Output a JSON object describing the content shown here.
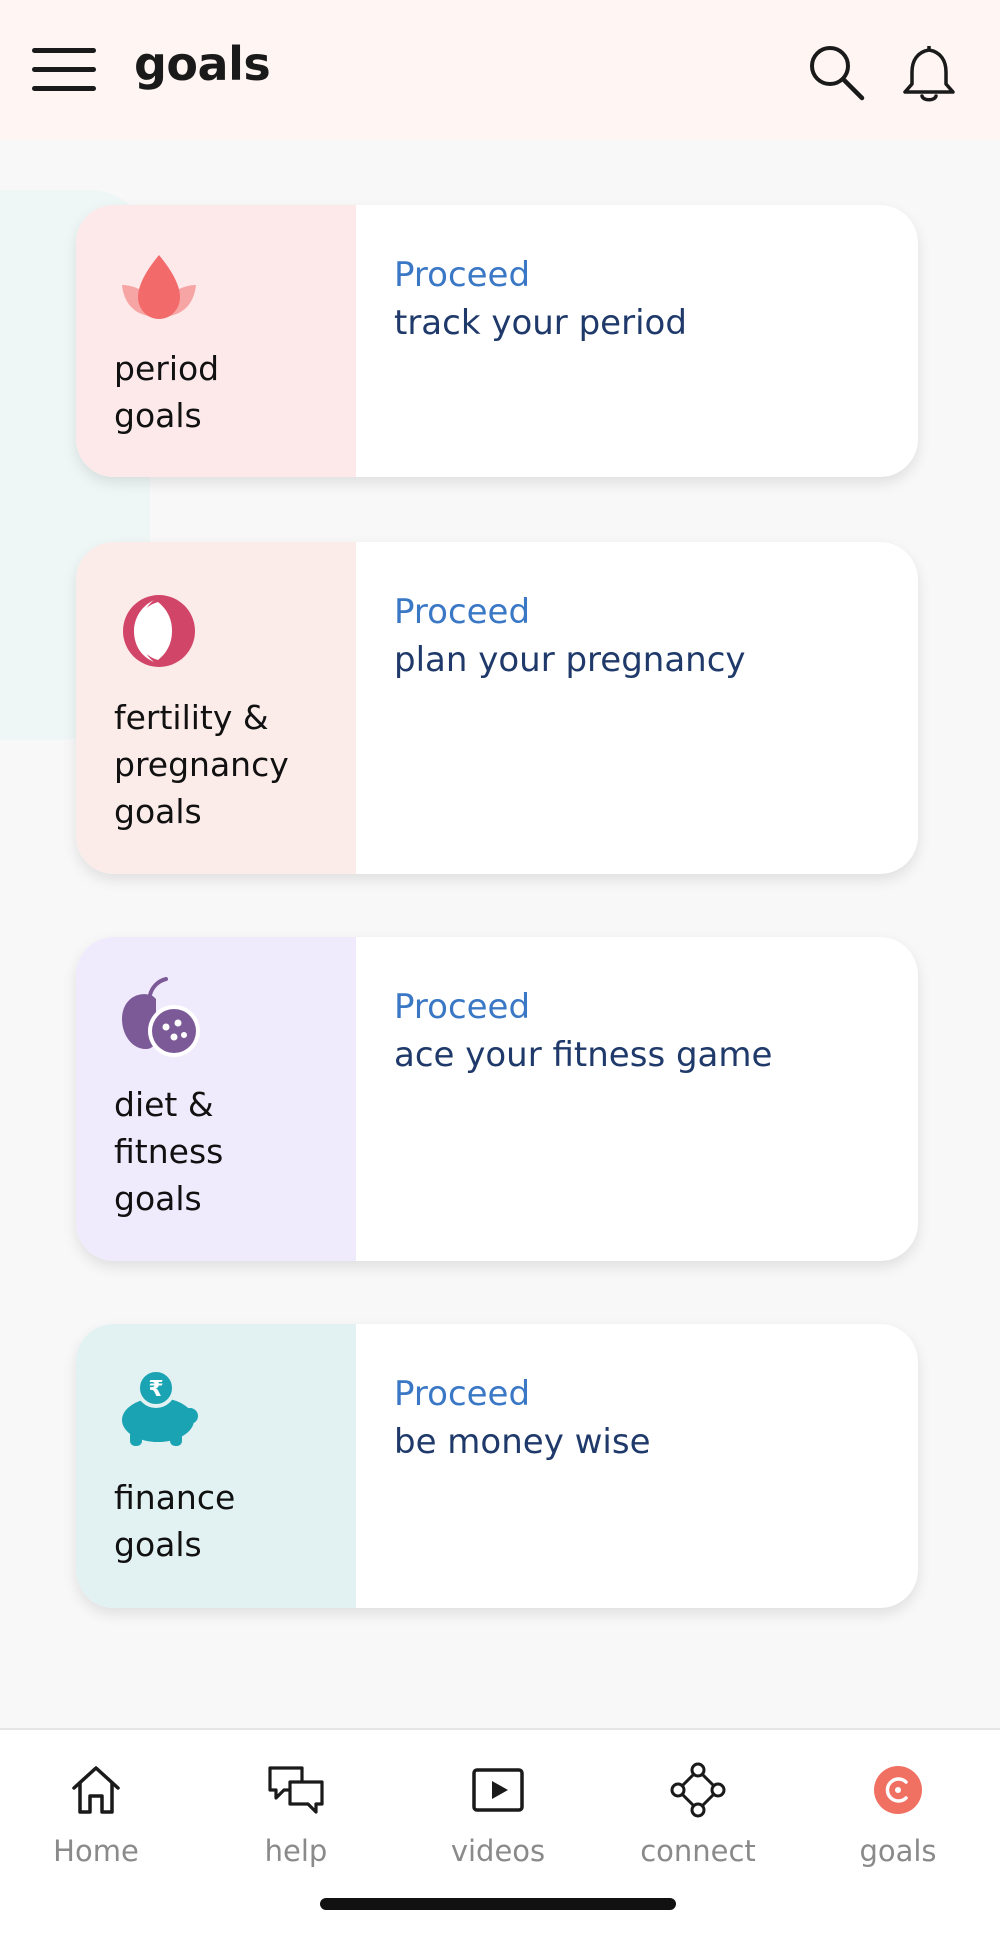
{
  "header": {
    "title": "goals",
    "menu_icon": "hamburger-menu-icon",
    "search_icon": "search-icon",
    "bell_icon": "bell-icon"
  },
  "cards": [
    {
      "name": "period\ngoals",
      "proceed": "Proceed",
      "description": "track your period",
      "icon": "lotus-icon",
      "bg_color": "#fde9ea",
      "icon_color": "#f26a6a"
    },
    {
      "name": "fertility &\npregnancy\ngoals",
      "proceed": "Proceed",
      "description": "plan your pregnancy",
      "icon": "moon-icon",
      "bg_color": "#fbecea",
      "icon_color": "#d14568"
    },
    {
      "name": "diet &\nfitness\ngoals",
      "proceed": "Proceed",
      "description": "ace your fitness game",
      "icon": "fruit-icon",
      "bg_color": "#f0ebfc",
      "icon_color": "#7c5a98"
    },
    {
      "name": "finance\ngoals",
      "proceed": "Proceed",
      "description": "be money wise",
      "icon": "piggy-bank-icon",
      "bg_color": "#e2f2f2",
      "icon_color": "#1aa3b2"
    }
  ],
  "nav": [
    {
      "label": "Home",
      "icon": "home-icon"
    },
    {
      "label": "help",
      "icon": "chat-icon"
    },
    {
      "label": "videos",
      "icon": "play-icon"
    },
    {
      "label": "connect",
      "icon": "connect-icon"
    },
    {
      "label": "goals",
      "icon": "goals-icon",
      "active_color": "#f07062"
    }
  ]
}
